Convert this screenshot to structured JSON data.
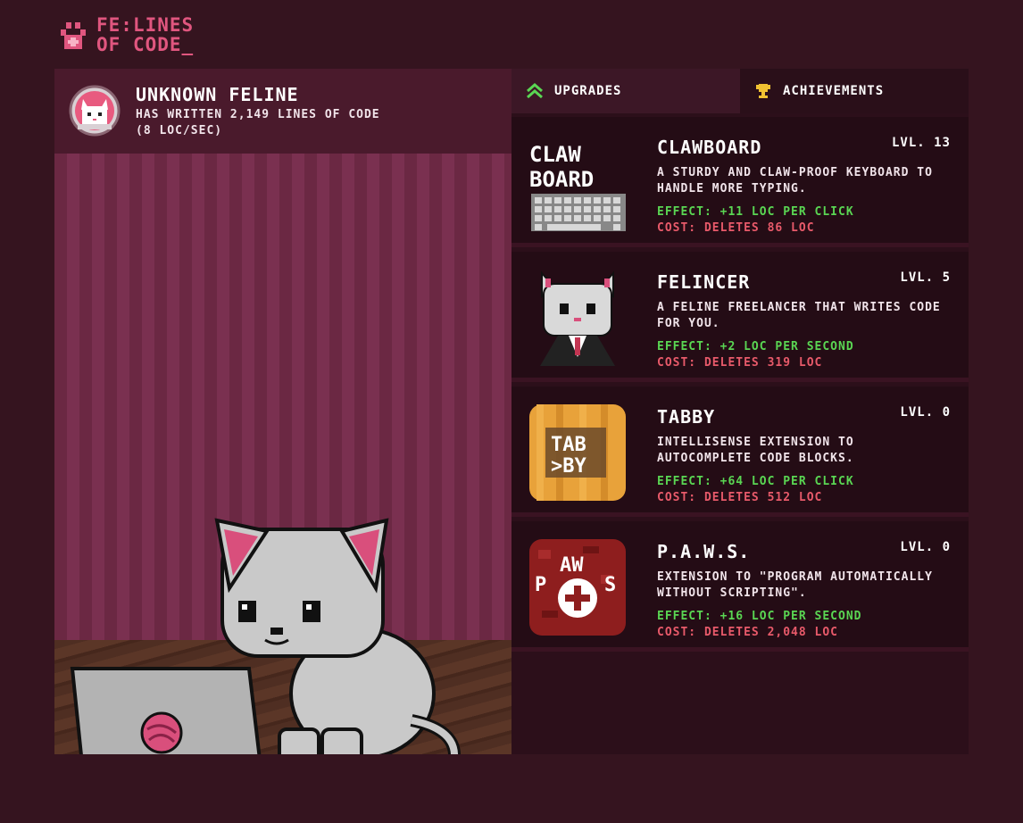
{
  "logo": {
    "line1_a": "FE",
    "line1_b": ":LINES",
    "line2_a": "OF",
    "line2_b": " CODE",
    "underscore": "_"
  },
  "profile": {
    "name": "UNKNOWN FELINE",
    "stat_lines": "HAS WRITTEN 2,149 LINES OF CODE",
    "stat_rate": "(8 LOC/SEC)"
  },
  "tabs": [
    {
      "label": "UPGRADES",
      "icon": "chevrons-up-icon",
      "active": true
    },
    {
      "label": "ACHIEVEMENTS",
      "icon": "trophy-icon",
      "active": false
    }
  ],
  "upgrades": [
    {
      "title": "CLAWBOARD",
      "level": "LVL. 13",
      "desc": "A STURDY AND CLAW-PROOF KEYBOARD TO HANDLE MORE TYPING.",
      "effect": "EFFECT: +11 LOC PER CLICK",
      "cost": "COST: DELETES 86 LOC",
      "icon": "keyboard-icon",
      "icon_text": "CLAW BOARD"
    },
    {
      "title": "FELINCER",
      "level": "LVL. 5",
      "desc": "A FELINE FREELANCER THAT WRITES CODE FOR YOU.",
      "effect": "EFFECT: +2 LOC PER SECOND",
      "cost": "COST: DELETES 319 LOC",
      "icon": "business-cat-icon"
    },
    {
      "title": "TABBY",
      "level": "LVL. 0",
      "desc": "INTELLISENSE EXTENSION TO AUTOCOMPLETE CODE BLOCKS.",
      "effect": "EFFECT: +64 LOC PER CLICK",
      "cost": "COST: DELETES 512 LOC",
      "icon": "tabby-extension-icon",
      "icon_text": "TAB >BY"
    },
    {
      "title": "P.A.W.S.",
      "level": "LVL. 0",
      "desc": "EXTENSION TO \"PROGRAM AUTOMATICALLY WITHOUT SCRIPTING\".",
      "effect": "EFFECT: +16 LOC PER SECOND",
      "cost": "COST: DELETES 2,048 LOC",
      "icon": "paws-extension-icon",
      "icon_text": "PAWS"
    }
  ],
  "colors": {
    "background": "#35141f",
    "accent": "#e0567f",
    "effect": "#5ad653",
    "cost": "#e85a6a",
    "panel": "#240c15"
  }
}
